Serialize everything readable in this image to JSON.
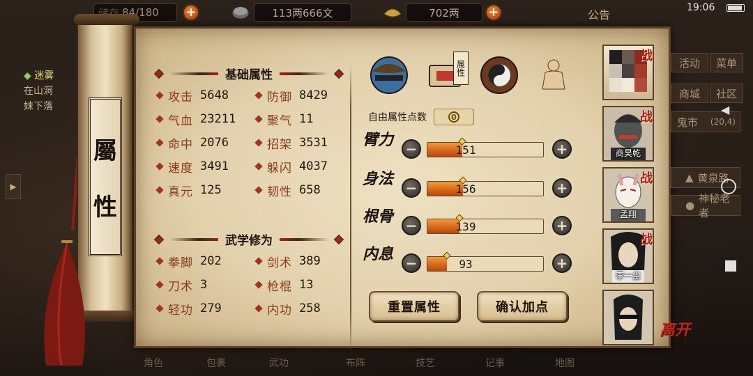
{
  "topbar": {
    "bag_label": "储存",
    "bag_count": "84/180",
    "money": "113两666文",
    "ingot": "702两",
    "notice": "公告",
    "time": "19:06"
  },
  "quest": {
    "title": "迷雾",
    "line1": "在山洞",
    "line2": "妹下落"
  },
  "scroll": {
    "char1": "屬",
    "char2": "性"
  },
  "basic": {
    "title": "基础属性",
    "stats": [
      {
        "label": "攻击",
        "value": "5648"
      },
      {
        "label": "防御",
        "value": "8429"
      },
      {
        "label": "气血",
        "value": "23211"
      },
      {
        "label": "聚气",
        "value": "11"
      },
      {
        "label": "命中",
        "value": "2076"
      },
      {
        "label": "招架",
        "value": "3531"
      },
      {
        "label": "速度",
        "value": "3491"
      },
      {
        "label": "躲闪",
        "value": "4037"
      },
      {
        "label": "真元",
        "value": "125"
      },
      {
        "label": "韧性",
        "value": "658"
      }
    ]
  },
  "martial": {
    "title": "武学修为",
    "stats": [
      {
        "label": "拳脚",
        "value": "202"
      },
      {
        "label": "剑术",
        "value": "389"
      },
      {
        "label": "刀术",
        "value": "3"
      },
      {
        "label": "枪棍",
        "value": "13"
      },
      {
        "label": "轻功",
        "value": "279"
      },
      {
        "label": "内功",
        "value": "258"
      }
    ]
  },
  "tabs": {
    "attr_badge": "属性"
  },
  "free_points": {
    "label": "自由属性点数",
    "value": "0"
  },
  "attributes": [
    {
      "name": "臂力",
      "value": "151",
      "fill_pct": 30
    },
    {
      "name": "身法",
      "value": "156",
      "fill_pct": 31
    },
    {
      "name": "根骨",
      "value": "139",
      "fill_pct": 28
    },
    {
      "name": "内息",
      "value": "93",
      "fill_pct": 17
    }
  ],
  "buttons": {
    "reset": "重置属性",
    "confirm": "确认加点",
    "minus": "−",
    "plus": "+"
  },
  "characters": [
    {
      "name": "",
      "tag": "战"
    },
    {
      "name": "商昊乾",
      "tag": "战"
    },
    {
      "name": "孟翔",
      "tag": "战"
    },
    {
      "name": "李一尘",
      "tag": "战"
    },
    {
      "name": "",
      "tag": ""
    }
  ],
  "leave": "离开",
  "side_menu": {
    "activity": "活动",
    "menu": "菜单",
    "mall": "商城",
    "community": "社区",
    "ghost_market": "鬼市",
    "coords": "(20,4)",
    "huangquan": "黄泉路",
    "mystery_elder": "神秘老者"
  },
  "bottom": [
    "角色",
    "包裹",
    "武功",
    "布阵",
    "技艺",
    "记事",
    "地图"
  ]
}
